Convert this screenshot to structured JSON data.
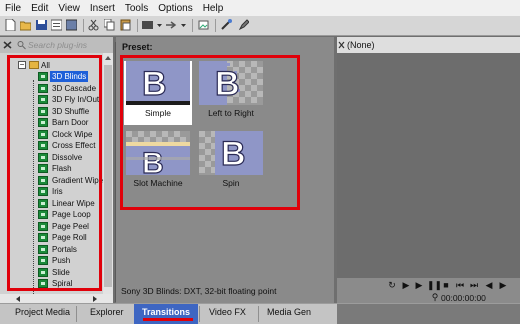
{
  "menubar": {
    "items": [
      "File",
      "Edit",
      "View",
      "Insert",
      "Tools",
      "Options",
      "Help"
    ]
  },
  "plugin_panel": {
    "search_placeholder": "Search plug-ins",
    "root_label": "All",
    "items": [
      "3D Blinds",
      "3D Cascade",
      "3D Fly In/Out",
      "3D Shuffle",
      "Barn Door",
      "Clock Wipe",
      "Cross Effect",
      "Dissolve",
      "Flash",
      "Gradient Wipe",
      "Iris",
      "Linear Wipe",
      "Page Loop",
      "Page Peel",
      "Page Roll",
      "Portals",
      "Push",
      "Slide",
      "Spiral"
    ],
    "selected_item": "3D Blinds"
  },
  "preset_panel": {
    "label": "Preset:",
    "presets": [
      {
        "name": "Simple",
        "glyph": "B",
        "selected": true
      },
      {
        "name": "Left to Right",
        "glyph": "B",
        "selected": false
      },
      {
        "name": "Slot Machine",
        "glyph": "B",
        "selected": false
      },
      {
        "name": "Spin",
        "glyph": "B",
        "selected": false
      }
    ],
    "status": "Sony 3D Blinds: DXT, 32-bit floating point"
  },
  "preview_panel": {
    "dropdown_value": "(None)",
    "timecode": "00:00:00:00"
  },
  "bottom_tabs": {
    "tabs": [
      "Project Media",
      "Explorer",
      "Transitions",
      "Video FX",
      "Media Gen"
    ],
    "active": "Transitions"
  },
  "colors": {
    "highlight": "#e0000a",
    "selection": "#1e5fd8",
    "active_tab": "#3e66c2"
  }
}
